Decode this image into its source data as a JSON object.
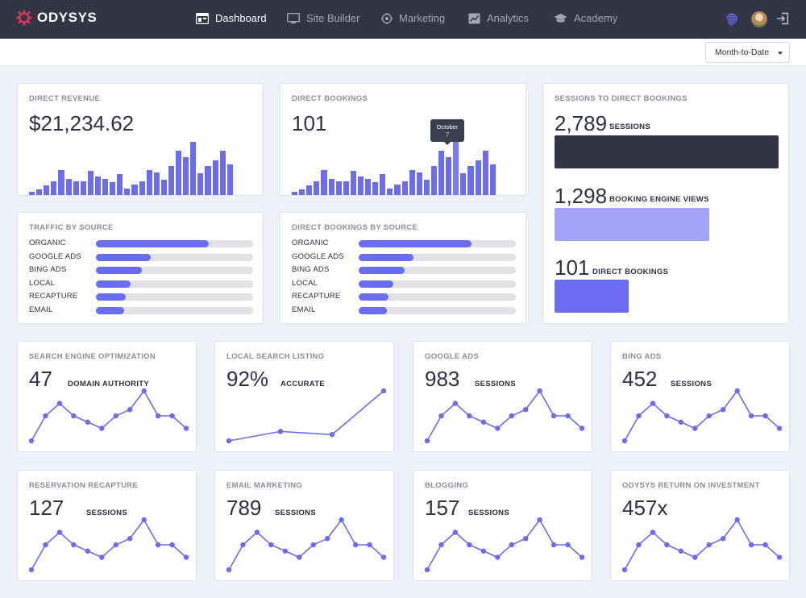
{
  "brand": {
    "name": "ODYSYS"
  },
  "nav": {
    "items": [
      {
        "label": "Dashboard",
        "icon": "dashboard-icon",
        "active": true
      },
      {
        "label": "Site Builder",
        "icon": "monitor-icon",
        "active": false
      },
      {
        "label": "Marketing",
        "icon": "target-icon",
        "active": false
      },
      {
        "label": "Analytics",
        "icon": "chart-icon",
        "active": false
      },
      {
        "label": "Academy",
        "icon": "graduation-cap-icon",
        "active": false
      }
    ],
    "right_icons": [
      "fingerprint-icon",
      "avatar",
      "logout-icon"
    ]
  },
  "filter": {
    "period": "Month-to-Date"
  },
  "colors": {
    "accent": "#6c6cf2",
    "dark": "#323644",
    "light_accent": "#a3a3f7"
  },
  "direct_revenue": {
    "title": "DIRECT REVENUE",
    "value": "$21,234.62",
    "chart_data": {
      "type": "bar",
      "values": [
        3,
        5,
        9,
        13,
        23,
        15,
        13,
        13,
        22,
        17,
        15,
        12,
        19,
        6,
        10,
        13,
        23,
        21,
        14,
        27,
        41,
        35,
        49,
        20,
        27,
        32,
        41,
        28
      ]
    }
  },
  "direct_bookings": {
    "title": "DIRECT BOOKINGS",
    "value": "101",
    "tooltip": {
      "month": "October",
      "day": "7"
    },
    "chart_data": {
      "type": "bar",
      "values": [
        3,
        5,
        9,
        13,
        23,
        15,
        13,
        13,
        22,
        17,
        15,
        12,
        19,
        6,
        10,
        13,
        23,
        21,
        14,
        27,
        41,
        35,
        49,
        20,
        27,
        32,
        41,
        28
      ]
    }
  },
  "sessions_funnel": {
    "title": "SESSIONS TO DIRECT BOOKINGS",
    "rows": [
      {
        "value": "2,789",
        "label": "SESSIONS",
        "fraction": 1.0,
        "color": "#323644"
      },
      {
        "value": "1,298",
        "label": "BOOKING ENGINE VIEWS",
        "fraction": 0.69,
        "color": "#a3a3f7"
      },
      {
        "value": "101",
        "label": "DIRECT BOOKINGS",
        "fraction": 0.33,
        "color": "#6c6cf2"
      }
    ]
  },
  "traffic_by_source": {
    "title": "TRAFFIC BY SOURCE",
    "rows": [
      {
        "label": "ORGANIC",
        "fraction": 0.72
      },
      {
        "label": "GOOGLE ADS",
        "fraction": 0.35
      },
      {
        "label": "BING ADS",
        "fraction": 0.29
      },
      {
        "label": "LOCAL",
        "fraction": 0.22
      },
      {
        "label": "RECAPTURE",
        "fraction": 0.19
      },
      {
        "label": "EMAIL",
        "fraction": 0.18
      }
    ]
  },
  "bookings_by_source": {
    "title": "DIRECT BOOKINGS BY SOURCE",
    "rows": [
      {
        "label": "ORGANIC",
        "fraction": 0.72
      },
      {
        "label": "GOOGLE ADS",
        "fraction": 0.35
      },
      {
        "label": "BING ADS",
        "fraction": 0.29
      },
      {
        "label": "LOCAL",
        "fraction": 0.22
      },
      {
        "label": "RECAPTURE",
        "fraction": 0.19
      },
      {
        "label": "EMAIL",
        "fraction": 0.18
      }
    ]
  },
  "kpis": [
    {
      "title": "SEARCH ENGINE OPTIMIZATION",
      "value": "47",
      "unit": "DOMAIN AUTHORITY",
      "chart_data": {
        "type": "line",
        "values": [
          1,
          5,
          7,
          5,
          4,
          3,
          5,
          6,
          9,
          5,
          5,
          3
        ]
      }
    },
    {
      "title": "LOCAL SEARCH LISTING",
      "value": "92%",
      "unit": "ACCURATE",
      "chart_data": {
        "type": "line",
        "values": [
          1,
          2.5,
          2,
          9
        ]
      }
    },
    {
      "title": "GOOGLE ADS",
      "value": "983",
      "unit": "SESSIONS",
      "chart_data": {
        "type": "line",
        "values": [
          1,
          5,
          7,
          5,
          4,
          3,
          5,
          6,
          9,
          5,
          5,
          3
        ]
      }
    },
    {
      "title": "BING ADS",
      "value": "452",
      "unit": "SESSIONS",
      "chart_data": {
        "type": "line",
        "values": [
          1,
          5,
          7,
          5,
          4,
          3,
          5,
          6,
          9,
          5,
          5,
          3
        ]
      }
    },
    {
      "title": "RESERVATION RECAPTURE",
      "value": "127",
      "unit": "SESSIONS",
      "chart_data": {
        "type": "line",
        "values": [
          1,
          5,
          7,
          5,
          4,
          3,
          5,
          6,
          9,
          5,
          5,
          3
        ]
      }
    },
    {
      "title": "EMAIL MARKETING",
      "value": "789",
      "unit": "SESSIONS",
      "chart_data": {
        "type": "line",
        "values": [
          1,
          5,
          7,
          5,
          4,
          3,
          5,
          6,
          9,
          5,
          5,
          3
        ]
      }
    },
    {
      "title": "BLOGGING",
      "value": "157",
      "unit": "SESSIONS",
      "chart_data": {
        "type": "line",
        "values": [
          1,
          5,
          7,
          5,
          4,
          3,
          5,
          6,
          9,
          5,
          5,
          3
        ]
      }
    },
    {
      "title": "ODYSYS RETURN ON INVESTMENT",
      "value": "457x",
      "unit": "",
      "chart_data": {
        "type": "line",
        "values": [
          1,
          5,
          7,
          5,
          4,
          3,
          5,
          6,
          9,
          5,
          5,
          3
        ]
      }
    }
  ]
}
